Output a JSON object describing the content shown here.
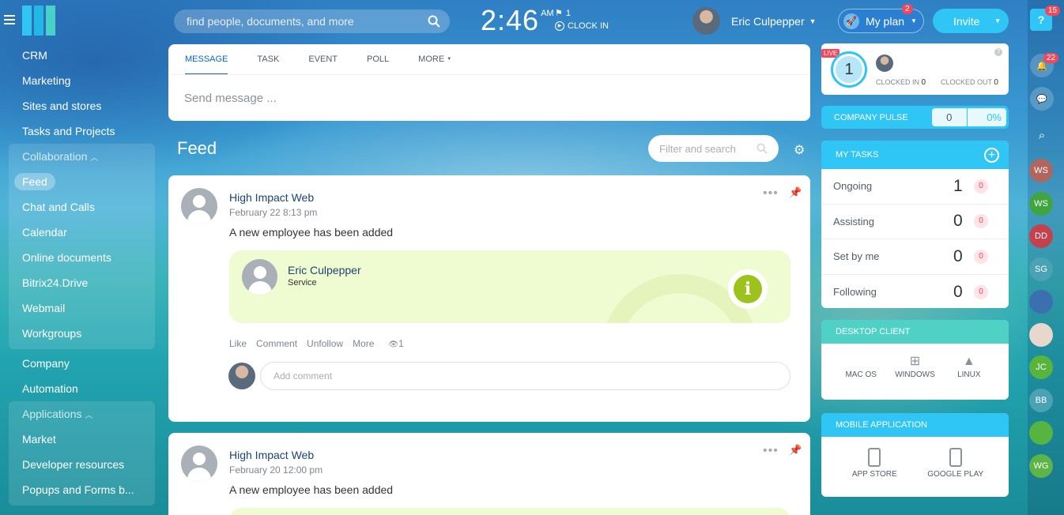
{
  "header": {
    "search_placeholder": "find people, documents, and more",
    "time": "2:46",
    "ampm": "AM",
    "flag_count": "1",
    "clock_in": "CLOCK IN",
    "user_name": "Eric Culpepper",
    "my_plan": "My plan",
    "my_plan_badge": "2",
    "invite": "Invite"
  },
  "sidebar": {
    "items_top": [
      "CRM",
      "Marketing",
      "Sites and stores",
      "Tasks and Projects"
    ],
    "collaboration": {
      "label": "Collaboration",
      "items": [
        "Feed",
        "Chat and Calls",
        "Calendar",
        "Online documents",
        "Bitrix24.Drive",
        "Webmail",
        "Workgroups"
      ]
    },
    "items_mid": [
      "Company",
      "Automation"
    ],
    "applications": {
      "label": "Applications",
      "items": [
        "Market",
        "Developer resources",
        "Popups and Forms b..."
      ]
    }
  },
  "composer": {
    "tabs": [
      "MESSAGE",
      "TASK",
      "EVENT",
      "POLL",
      "MORE"
    ],
    "placeholder": "Send message ..."
  },
  "feed": {
    "title": "Feed",
    "filter_placeholder": "Filter and search",
    "posts": [
      {
        "author": "High Impact Web",
        "date": "February 22 8:13 pm",
        "text": "A new employee has been added",
        "employee_name": "Eric Culpepper",
        "employee_dept": "Service",
        "actions": [
          "Like",
          "Comment",
          "Unfollow",
          "More"
        ],
        "views": "1",
        "comment_placeholder": "Add comment"
      },
      {
        "author": "High Impact Web",
        "date": "February 20 12:00 pm",
        "text": "A new employee has been added"
      }
    ]
  },
  "timeman": {
    "live": "LIVE",
    "count": "1",
    "clocked_in_label": "CLOCKED IN",
    "clocked_in": "0",
    "clocked_out_label": "CLOCKED OUT",
    "clocked_out": "0"
  },
  "pulse": {
    "label": "COMPANY PULSE",
    "value": "0",
    "percent": "0%"
  },
  "my_tasks": {
    "title": "MY TASKS",
    "rows": [
      {
        "label": "Ongoing",
        "value": "1",
        "counter": "0"
      },
      {
        "label": "Assisting",
        "value": "0",
        "counter": "0"
      },
      {
        "label": "Set by me",
        "value": "0",
        "counter": "0"
      },
      {
        "label": "Following",
        "value": "0",
        "counter": "0"
      }
    ]
  },
  "desktop_client": {
    "title": "DESKTOP CLIENT",
    "items": [
      "MAC OS",
      "WINDOWS",
      "LINUX"
    ]
  },
  "mobile_app": {
    "title": "MOBILE APPLICATION",
    "items": [
      "APP STORE",
      "GOOGLE PLAY"
    ]
  },
  "rail": {
    "help_badge": "15",
    "notif_badge": "22",
    "contacts": [
      {
        "initials": "WS",
        "color": "#b0665e"
      },
      {
        "initials": "WS",
        "color": "#3fa53f"
      },
      {
        "initials": "DD",
        "color": "#c4414d"
      },
      {
        "initials": "SG",
        "color": "#4aa3b5"
      },
      {
        "initials": "",
        "color": "#3b6fb0"
      },
      {
        "initials": "",
        "color": "#e7d7cc"
      },
      {
        "initials": "JC",
        "color": "#58b53c"
      },
      {
        "initials": "BB",
        "color": "#4aa3b5"
      },
      {
        "initials": "",
        "color": "#55b540"
      },
      {
        "initials": "WG",
        "color": "#5db547"
      }
    ]
  },
  "colors": {
    "accent": "#2fc6f6",
    "link": "#0b66c3",
    "alert": "#f5475b"
  }
}
